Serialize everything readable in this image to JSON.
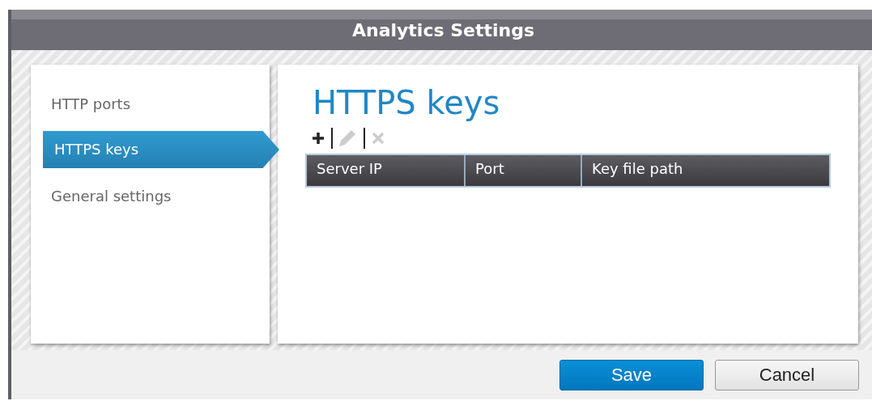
{
  "window": {
    "title": "Analytics Settings"
  },
  "sidebar": {
    "items": [
      {
        "label": "HTTP ports",
        "selected": false
      },
      {
        "label": "HTTPS keys",
        "selected": true
      },
      {
        "label": "General settings",
        "selected": false
      }
    ]
  },
  "content": {
    "heading": "HTTPS keys",
    "toolbar": [
      {
        "kind": "add",
        "disabled": false
      },
      {
        "kind": "edit",
        "disabled": true
      },
      {
        "kind": "delete",
        "disabled": true
      }
    ],
    "table": {
      "columns": [
        "Server IP",
        "Port",
        "Key file path"
      ]
    }
  },
  "buttons": [
    {
      "label": "Save",
      "kind": "primary"
    },
    {
      "label": "Cancel",
      "kind": "secondary"
    }
  ]
}
